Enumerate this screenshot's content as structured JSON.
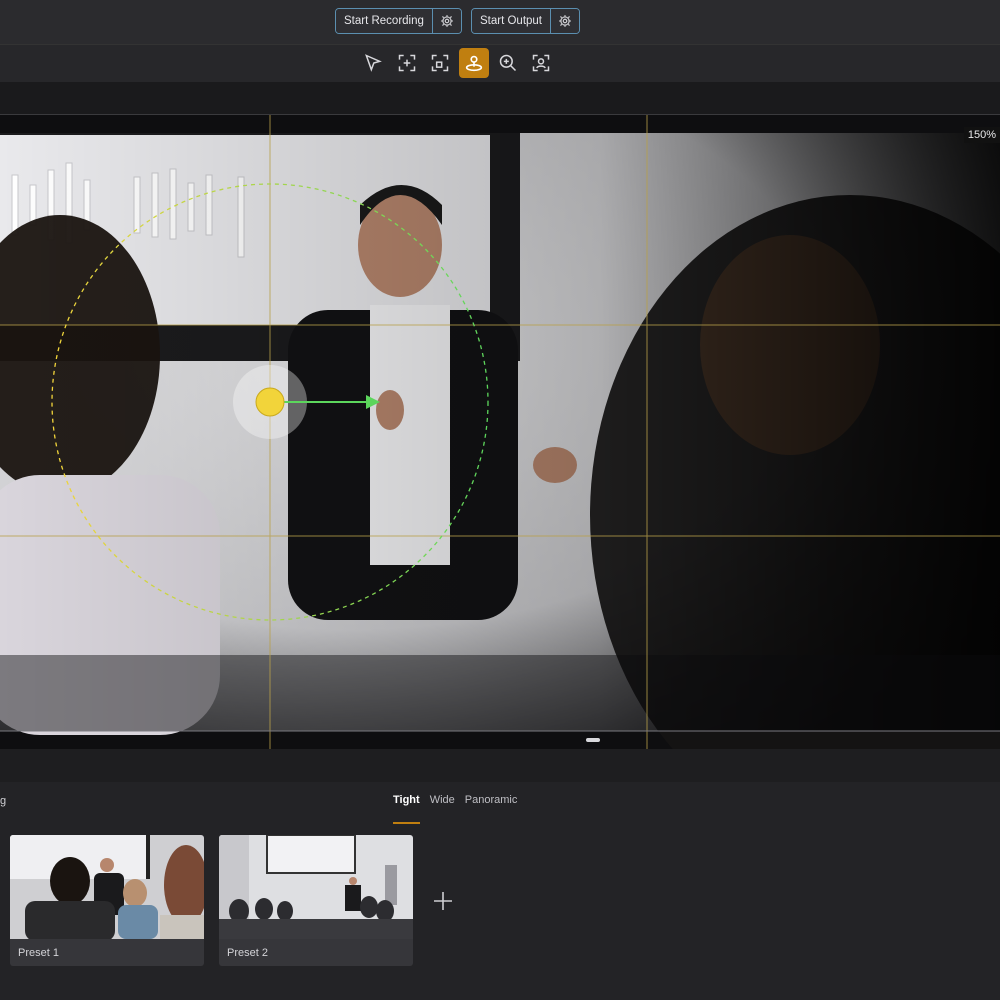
{
  "header": {
    "start_recording": "Start Recording",
    "start_output": "Start Output",
    "recording_settings_icon": "gear-icon",
    "output_settings_icon": "gear-icon"
  },
  "toolbar": {
    "tools": [
      {
        "name": "select-tool",
        "icon": "pointer-icon",
        "active": false
      },
      {
        "name": "add-frame-tool",
        "icon": "frame-add-icon",
        "active": false
      },
      {
        "name": "crop-tool",
        "icon": "crop-frame-icon",
        "active": false
      },
      {
        "name": "tracking-tool",
        "icon": "pan-target-icon",
        "active": true
      },
      {
        "name": "zoom-tool",
        "icon": "zoom-in-icon",
        "active": false
      },
      {
        "name": "face-tool",
        "icon": "face-frame-icon",
        "active": false
      }
    ],
    "active_color": "#c07f10"
  },
  "viewport": {
    "zoom": "150%",
    "grid_color": "#b8a04a",
    "target_color": "#f2d43a",
    "vector_color": "#5cd65c"
  },
  "presets_panel": {
    "title": "g",
    "tabs": [
      "Tight",
      "Wide",
      "Panoramic"
    ],
    "active_tab": "Tight",
    "presets": [
      {
        "name": "Preset 1"
      },
      {
        "name": "Preset 2"
      }
    ],
    "add_icon": "plus-icon"
  }
}
